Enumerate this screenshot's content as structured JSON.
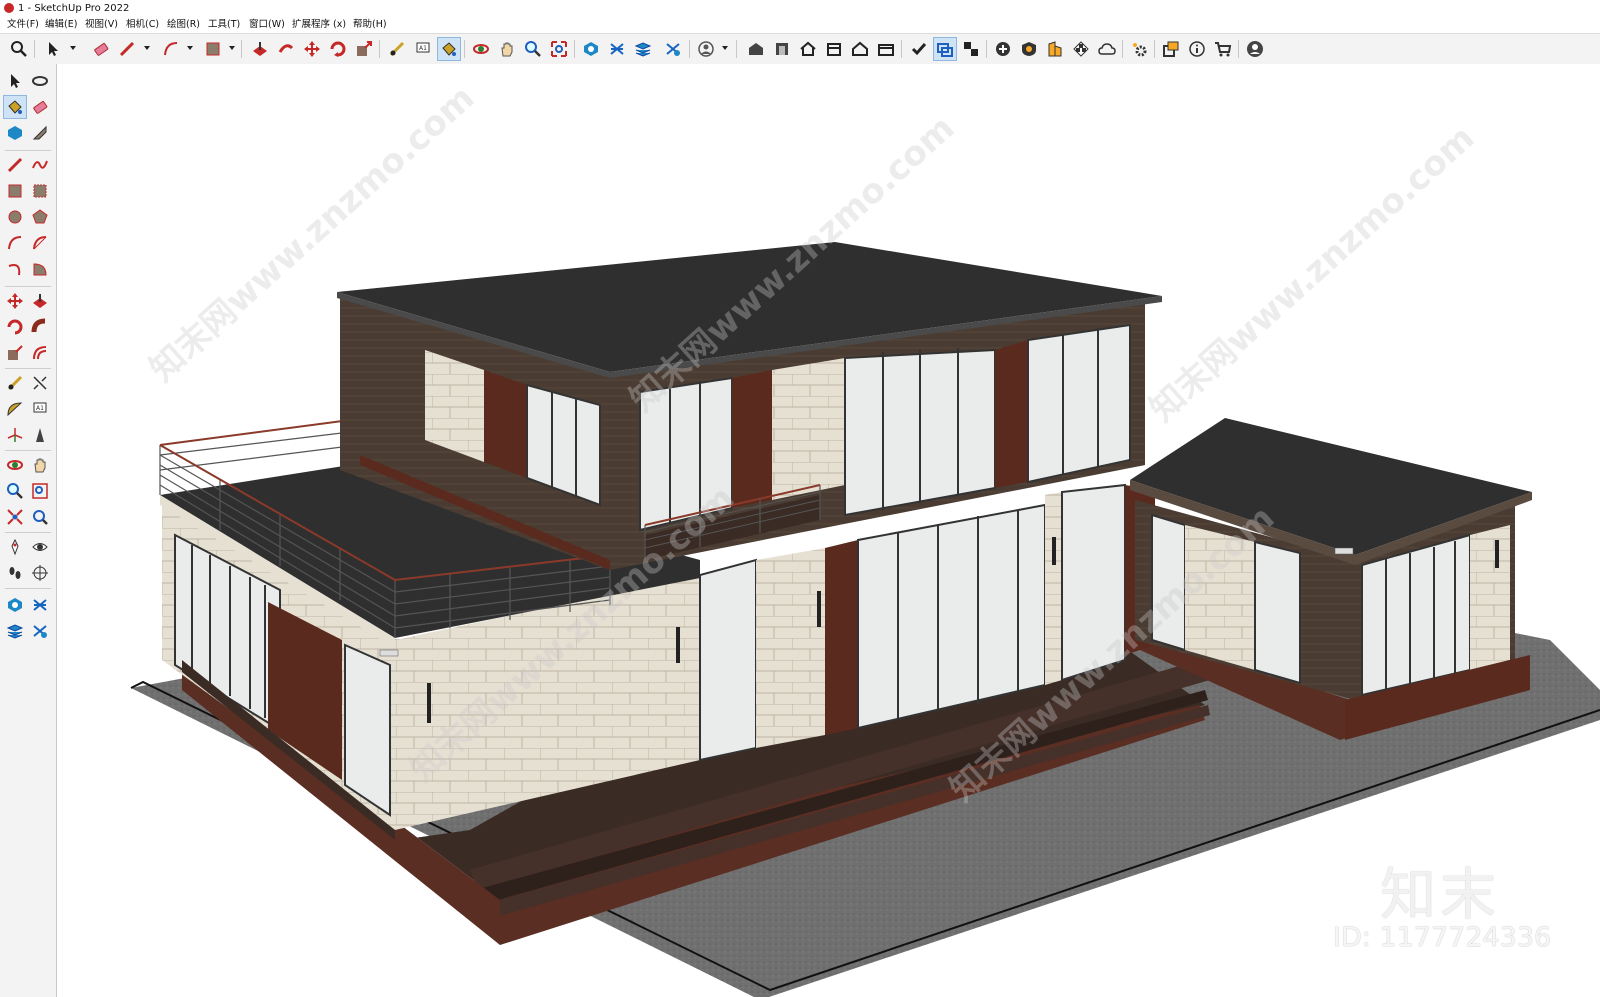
{
  "window": {
    "title": "1 - SketchUp Pro 2022"
  },
  "menu": [
    {
      "label": "文件(F)"
    },
    {
      "label": "编辑(E)"
    },
    {
      "label": "视图(V)"
    },
    {
      "label": "相机(C)"
    },
    {
      "label": "绘图(R)"
    },
    {
      "label": "工具(T)"
    },
    {
      "label": "窗口(W)"
    },
    {
      "label": "扩展程序 (x)"
    },
    {
      "label": "帮助(H)"
    }
  ],
  "icons": {
    "top": [
      "search-icon",
      "select-icon",
      "eraser-icon",
      "pencil-icon",
      "arc-icon",
      "rectangle-icon",
      "push-pull-icon",
      "follow-me-icon",
      "move-icon",
      "rotate-icon",
      "scale-icon",
      "tape-measure-icon",
      "text-icon",
      "paint-bucket-icon",
      "orbit-icon",
      "pan-icon",
      "zoom-icon",
      "zoom-extents-icon",
      "sandbox-icon",
      "section-icon",
      "layers-icon",
      "styles-icon",
      "profile-icon",
      "warehouse-icon",
      "extension-warehouse-icon",
      "house-icon",
      "house-outline-icon",
      "component-icon",
      "model-info-icon",
      "outliner-icon",
      "scenes-icon",
      "add-icon",
      "shadows-icon",
      "materials-icon",
      "checker-icon",
      "cloud-icon",
      "settings-icon",
      "window-icon",
      "info-icon",
      "cart-icon",
      "account-icon"
    ],
    "left": [
      "select-icon",
      "orbit-icon",
      "paint-bucket-icon",
      "eraser-icon",
      "component-icon",
      "tape-icon",
      "pencil-icon",
      "freehand-icon",
      "rectangle-icon",
      "rotated-rectangle-icon",
      "circle-icon",
      "polygon-icon",
      "arc-icon",
      "pie-icon",
      "arc-3pt-icon",
      "pie-2-icon",
      "move-icon",
      "push-pull-icon",
      "rotate-icon",
      "follow-me-icon",
      "scale-icon",
      "offset-icon",
      "tape-measure-icon",
      "dimension-icon",
      "protractor-icon",
      "text-icon",
      "axes-icon",
      "3d-text-icon",
      "orbit-icon",
      "pan-icon",
      "zoom-icon",
      "zoom-window-icon",
      "zoom-extents-icon",
      "previous-view-icon",
      "position-camera-icon",
      "look-around-icon",
      "walk-icon",
      "section-plane-icon",
      "sandbox-icon",
      "stamp-icon",
      "layers-icon",
      "styles-icon"
    ]
  },
  "watermark": {
    "logo": "知末",
    "id": "ID: 1177724336",
    "diagonal_text": "知末网www.znzmo.com"
  },
  "colors": {
    "roof": "#2f2f2f",
    "wood_cladding": "#4a3c32",
    "stone": "#e6e0d3",
    "deck": "#3b2b25",
    "deck_edge": "#5a2e22",
    "ground": "#6f6f6f",
    "glass": "#e9eceb",
    "accent_wood": "#5b2a1e"
  }
}
